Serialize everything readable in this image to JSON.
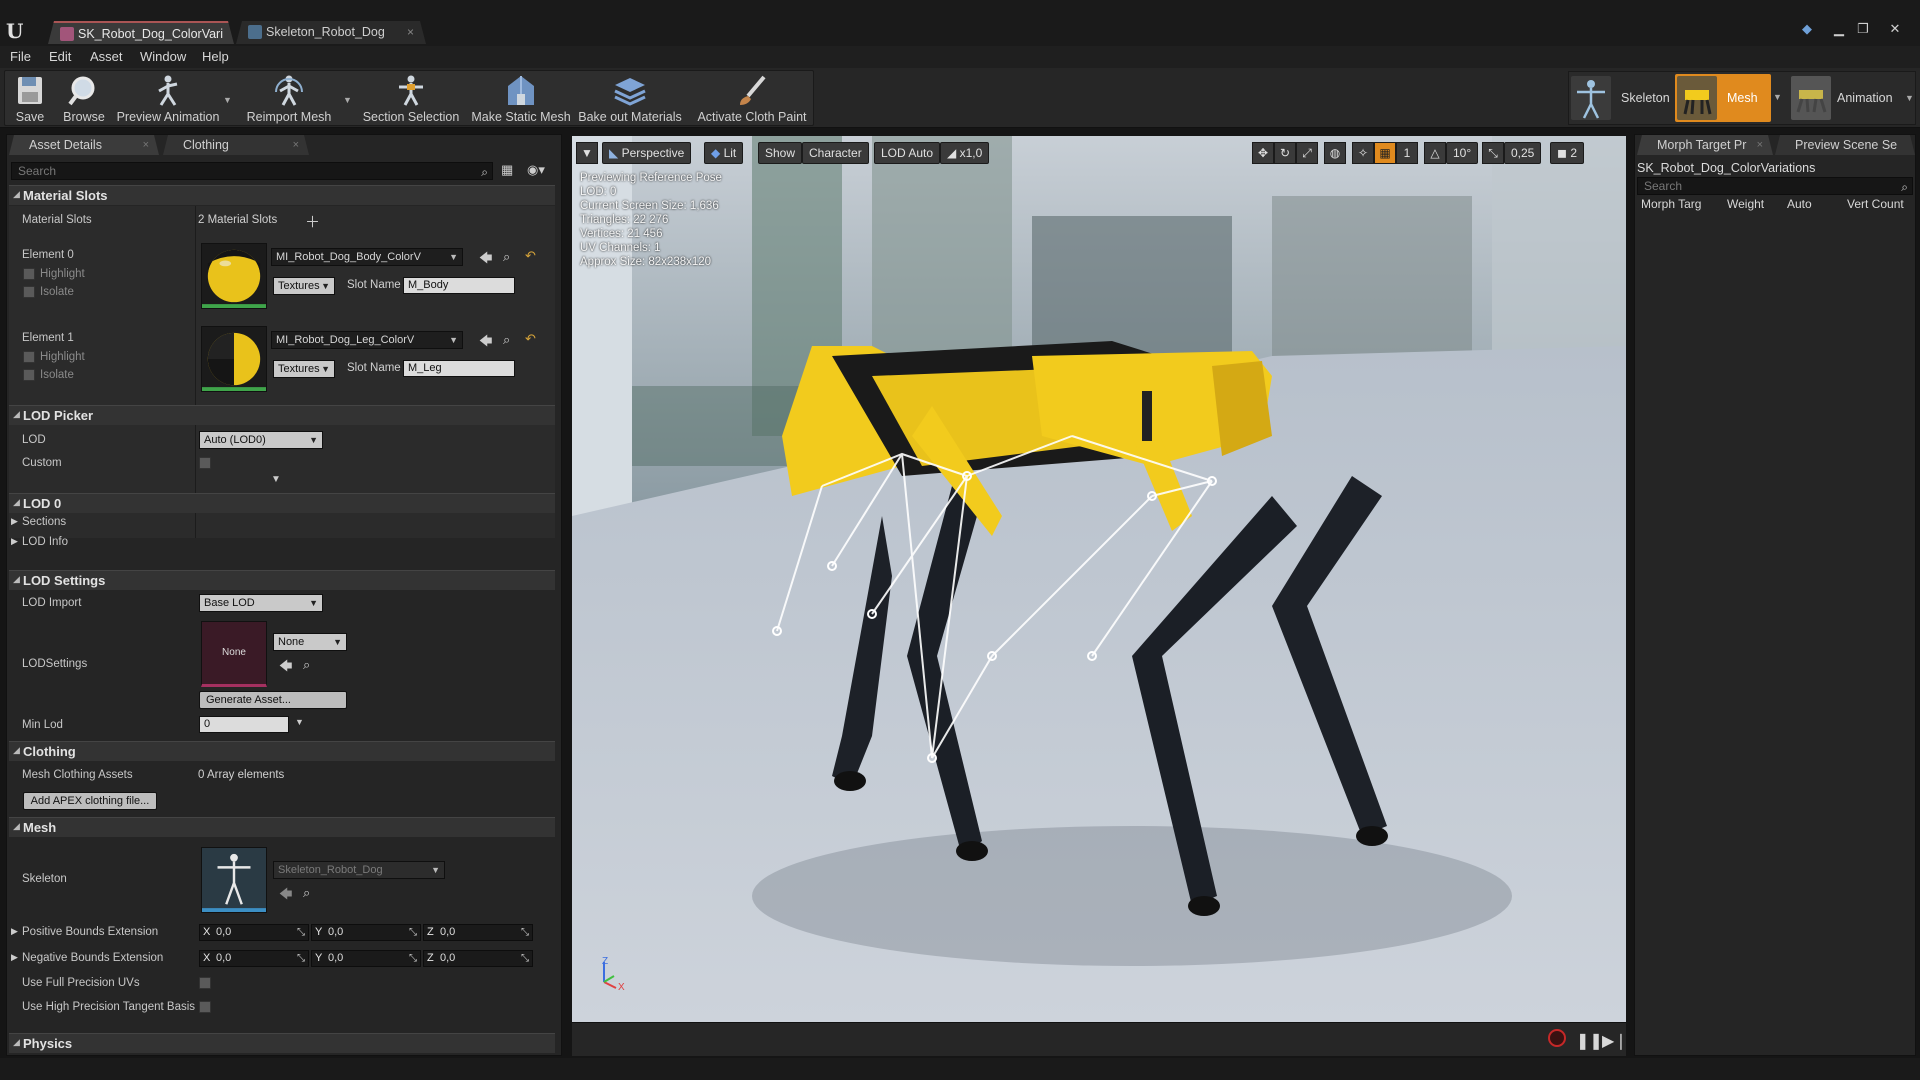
{
  "tabs": [
    {
      "label": "SK_Robot_Dog_ColorVari"
    },
    {
      "label": "Skeleton_Robot_Dog"
    }
  ],
  "menu": [
    "File",
    "Edit",
    "Asset",
    "Window",
    "Help"
  ],
  "toolbar": {
    "save": "Save",
    "browse": "Browse",
    "preview_animation": "Preview Animation",
    "reimport_mesh": "Reimport Mesh",
    "section_selection": "Section Selection",
    "make_static_mesh": "Make Static Mesh",
    "bake_out_materials": "Bake out Materials",
    "activate_cloth_paint": "Activate Cloth Paint"
  },
  "modes": {
    "skeleton": "Skeleton",
    "mesh": "Mesh",
    "animation": "Animation"
  },
  "details": {
    "tab_asset_details": "Asset Details",
    "tab_clothing": "Clothing",
    "search_placeholder": "Search",
    "material_slots": {
      "title": "Material Slots",
      "label": "Material Slots",
      "count": "2 Material Slots",
      "elements": [
        {
          "name": "Element 0",
          "highlight": "Highlight",
          "isolate": "Isolate",
          "material": "MI_Robot_Dog_Body_ColorV",
          "textures": "Textures",
          "slot_name_label": "Slot Name",
          "slot_name": "M_Body"
        },
        {
          "name": "Element 1",
          "highlight": "Highlight",
          "isolate": "Isolate",
          "material": "MI_Robot_Dog_Leg_ColorV",
          "textures": "Textures",
          "slot_name_label": "Slot Name",
          "slot_name": "M_Leg"
        }
      ]
    },
    "lod_picker": {
      "title": "LOD Picker",
      "lod_label": "LOD",
      "lod_value": "Auto (LOD0)",
      "custom_label": "Custom"
    },
    "lod0": {
      "title": "LOD 0",
      "sections": "Sections",
      "lod_info": "LOD Info"
    },
    "lod_settings": {
      "title": "LOD Settings",
      "lod_import_label": "LOD Import",
      "lod_import_value": "Base LOD",
      "lodsettings_label": "LODSettings",
      "asset_thumb": "None",
      "asset_value": "None",
      "generate": "Generate Asset...",
      "min_lod_label": "Min Lod",
      "min_lod_value": "0"
    },
    "clothing": {
      "title": "Clothing",
      "mesh_clothing_label": "Mesh Clothing Assets",
      "mesh_clothing_value": "0 Array elements",
      "add_apex": "Add APEX clothing file..."
    },
    "mesh": {
      "title": "Mesh",
      "skeleton_label": "Skeleton",
      "skeleton_value": "Skeleton_Robot_Dog",
      "pos_bounds_label": "Positive Bounds Extension",
      "neg_bounds_label": "Negative Bounds Extension",
      "x_axis": "X",
      "y_axis": "Y",
      "z_axis": "Z",
      "pos_x": "0,0",
      "pos_y": "0,0",
      "pos_z": "0,0",
      "neg_x": "0,0",
      "neg_y": "0,0",
      "neg_z": "0,0",
      "full_precision_uvs": "Use Full Precision UVs",
      "high_precision_tangent": "Use High Precision Tangent Basis"
    },
    "physics": {
      "title": "Physics"
    }
  },
  "viewport": {
    "perspective": "Perspective",
    "lit": "Lit",
    "show": "Show",
    "character": "Character",
    "lod_auto": "LOD Auto",
    "speed": "x1,0",
    "angle_snap": "10°",
    "scale_snap": "0,25",
    "camera_speed": "2",
    "number_one": "1",
    "axis_z": "Z",
    "axis_x": "X",
    "info": [
      "Previewing Reference Pose",
      "LOD: 0",
      "Current Screen Size: 1,636",
      "Triangles: 22 276",
      "Vertices: 21 456",
      "UV Channels: 1",
      "Approx Size: 82x238x120"
    ]
  },
  "right_panel": {
    "tab_morph": "Morph Target Pr",
    "tab_preview": "Preview Scene Se",
    "asset_name": "SK_Robot_Dog_ColorVariations",
    "search_placeholder": "Search",
    "columns": [
      "Morph Targ",
      "Weight",
      "Auto",
      "Vert Count"
    ]
  },
  "colors": {
    "accent_orange": "#e08a1e",
    "mesh_yellow": "#f2cb1d",
    "record_red": "#c62828"
  }
}
